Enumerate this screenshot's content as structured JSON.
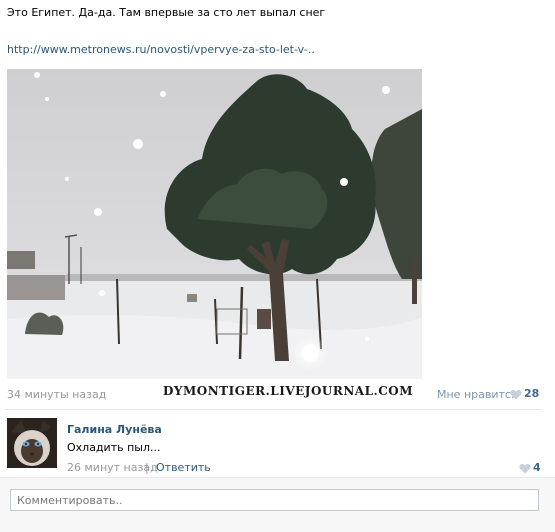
{
  "post": {
    "text": "Это Египет. Да-да. Там впервые за сто лет выпал снег",
    "link": "http://www.metronews.ru/novosti/vpervye-za-sto-let-v-..",
    "time": "34 минуты назад",
    "watermark": "DYMONTIGER.LIVEJOURNAL.COM",
    "like_label": "Мне нравится",
    "like_count": "28"
  },
  "comment": {
    "author": "Галина Лунёва",
    "text": "Охладить пыл...",
    "time": "26 минут назад",
    "separator": "|",
    "reply_label": "Ответить",
    "like_count": "4"
  },
  "comment_input": {
    "placeholder": "Комментировать.."
  },
  "icons": {
    "like": "heart-icon"
  },
  "colors": {
    "link": "#2b587a",
    "muted": "#999999",
    "like_count": "#45688e",
    "heart": "#c5d0db"
  }
}
